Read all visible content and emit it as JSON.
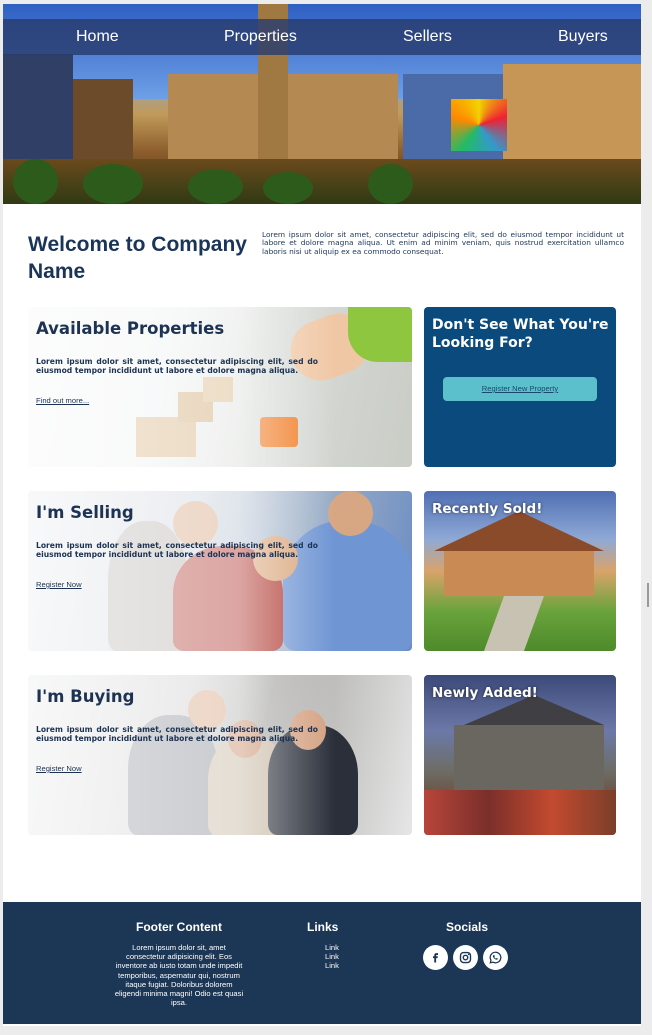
{
  "nav": {
    "items": [
      {
        "label": "Home"
      },
      {
        "label": "Properties"
      },
      {
        "label": "Sellers"
      },
      {
        "label": "Buyers"
      }
    ]
  },
  "welcome": {
    "title": "Welcome to Company Name",
    "text": "Lorem ipsum dolor sit amet, consectetur adipiscing elit, sed do eiusmod tempor incididunt ut labore et dolore magna aliqua. Ut enim ad minim veniam, quis nostrud exercitation ullamco laboris nisi ut aliquip ex ea commodo consequat."
  },
  "cards": {
    "properties": {
      "title": "Available Properties",
      "text": "Lorem ipsum dolor sit amet, consectetur adipiscing elit, sed do eiusmod tempor incididunt ut labore et dolore magna aliqua.",
      "link": "Find out more..."
    },
    "selling": {
      "title": "I'm Selling",
      "text": "Lorem ipsum dolor sit amet, consectetur adipiscing elit, sed do eiusmod tempor incididunt ut labore et dolore magna aliqua.",
      "link": "Register Now"
    },
    "buying": {
      "title": "I'm Buying",
      "text": "Lorem ipsum dolor sit amet, consectetur adipiscing elit, sed do eiusmod tempor incididunt ut labore et dolore magna aliqua.",
      "link": "Register Now"
    },
    "cta": {
      "title": "Don't See What You're Looking For?",
      "button": "Register New Property",
      "bg_color": "#0b4a7d",
      "button_color": "#5bc0cb"
    },
    "sold": {
      "title": "Recently Sold!"
    },
    "new": {
      "title": "Newly Added!"
    }
  },
  "footer": {
    "content_title": "Footer Content",
    "content_text": "Lorem ipsum dolor sit, amet consectetur adipisicing elit. Eos inventore ab iusto totam unde impedit temporibus, aspernatur qui, nostrum itaque fugiat. Doloribus dolorem eligendi minima magni! Odio est quasi ipsa.",
    "links_title": "Links",
    "links": [
      "Link",
      "Link",
      "Link"
    ],
    "socials_title": "Socials",
    "socials": [
      {
        "icon": "facebook-icon"
      },
      {
        "icon": "instagram-icon"
      },
      {
        "icon": "whatsapp-icon"
      }
    ],
    "bg_color": "#1c3655"
  },
  "colors": {
    "heading": "#1a3558",
    "nav_bar": "rgba(40,60,110,0.82)"
  }
}
